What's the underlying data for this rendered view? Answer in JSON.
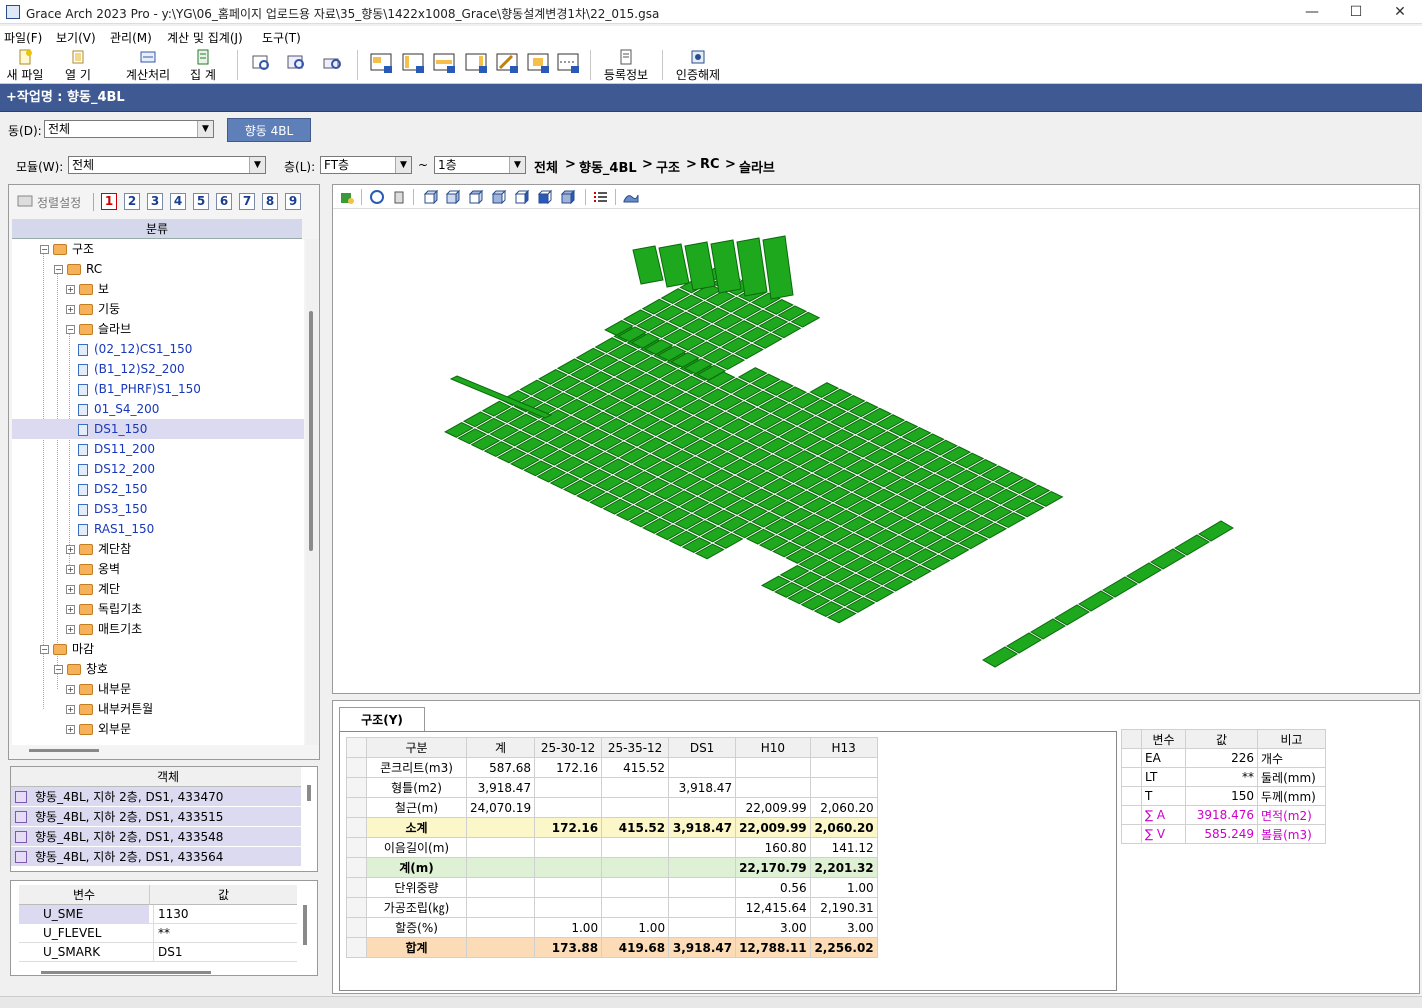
{
  "window": {
    "title": "Grace Arch 2023 Pro - y:\\YG\\06_홈페이지 업로드용 자료\\35_향동\\1422x1008_Grace\\향동설계변경1차\\22_015.gsa",
    "min": "—",
    "max": "☐",
    "close": "✕"
  },
  "menu": [
    "파일(F)",
    "보기(V)",
    "관리(M)",
    "계산 및 집계(J)",
    "도구(T)"
  ],
  "toolbar": {
    "new": "새 파일",
    "open": "열  기",
    "calc": "계산처리",
    "sum": "집  계",
    "reg": "등록정보",
    "auth": "인증해제"
  },
  "job": "+작업명 : 향동_4BL",
  "dong": {
    "label": "동(D):",
    "value": "전체",
    "tab": "향동 4BL"
  },
  "filters": {
    "module_label": "모듈(W):",
    "module_value": "전체",
    "floor_label": "층(L):",
    "floor_from": "FT층",
    "tilde": "~",
    "floor_to": "1층"
  },
  "breadcrumb": [
    "전체",
    "향동_4BL",
    "구조",
    "RC",
    "슬라브"
  ],
  "crumb_sep": ">",
  "left": {
    "sort_label": "정렬설정",
    "numbers": [
      "1",
      "2",
      "3",
      "4",
      "5",
      "6",
      "7",
      "8",
      "9"
    ],
    "tree_header": "분류"
  },
  "tree": [
    {
      "label": "구조",
      "kind": "folder",
      "exp": "−"
    },
    {
      "label": "RC",
      "kind": "folder",
      "exp": "−"
    },
    {
      "label": "보",
      "kind": "folder",
      "exp": "+"
    },
    {
      "label": "기둥",
      "kind": "folder",
      "exp": "+"
    },
    {
      "label": "슬라브",
      "kind": "folder",
      "exp": "−"
    },
    {
      "label": "(02_12)CS1_150",
      "kind": "doc"
    },
    {
      "label": "(B1_12)S2_200",
      "kind": "doc"
    },
    {
      "label": "(B1_PHRF)S1_150",
      "kind": "doc"
    },
    {
      "label": "01_S4_200",
      "kind": "doc"
    },
    {
      "label": "DS1_150",
      "kind": "doc",
      "selected": true
    },
    {
      "label": "DS11_200",
      "kind": "doc"
    },
    {
      "label": "DS12_200",
      "kind": "doc"
    },
    {
      "label": "DS2_150",
      "kind": "doc"
    },
    {
      "label": "DS3_150",
      "kind": "doc"
    },
    {
      "label": "RAS1_150",
      "kind": "doc"
    },
    {
      "label": "계단참",
      "kind": "folder",
      "exp": "+"
    },
    {
      "label": "옹벽",
      "kind": "folder",
      "exp": "+"
    },
    {
      "label": "계단",
      "kind": "folder",
      "exp": "+"
    },
    {
      "label": "독립기초",
      "kind": "folder",
      "exp": "+"
    },
    {
      "label": "매트기초",
      "kind": "folder",
      "exp": "+"
    },
    {
      "label": "마감",
      "kind": "folder",
      "exp": "−"
    },
    {
      "label": "창호",
      "kind": "folder",
      "exp": "−"
    },
    {
      "label": "내부문",
      "kind": "folder",
      "exp": "+"
    },
    {
      "label": "내부커튼월",
      "kind": "folder",
      "exp": "+"
    },
    {
      "label": "외부문",
      "kind": "folder",
      "exp": "+"
    }
  ],
  "objects": {
    "header": "객체",
    "rows": [
      "향동_4BL, 지하 2층, DS1, 433470",
      "향동_4BL, 지하 2층, DS1, 433515",
      "향동_4BL, 지하 2층, DS1, 433548",
      "향동_4BL, 지하 2층, DS1, 433564"
    ]
  },
  "vars": {
    "h1": "변수",
    "h2": "값",
    "rows": [
      [
        "U_SME",
        "1130"
      ],
      [
        "U_FLEVEL",
        "**"
      ],
      [
        "U_SMARK",
        "DS1"
      ]
    ]
  },
  "grid": {
    "tab": "구조(Y)",
    "headers": [
      "구분",
      "계",
      "25-30-12",
      "25-35-12",
      "DS1",
      "H10",
      "H13"
    ],
    "rows": [
      {
        "cells": [
          "콘크리트(m3)",
          "587.68",
          "172.16",
          "415.52",
          "",
          "",
          ""
        ],
        "style": ""
      },
      {
        "cells": [
          "형틀(m2)",
          "3,918.47",
          "",
          "",
          "3,918.47",
          "",
          ""
        ],
        "style": ""
      },
      {
        "cells": [
          "철근(m)",
          "24,070.19",
          "",
          "",
          "",
          "22,009.99",
          "2,060.20"
        ],
        "style": ""
      },
      {
        "cells": [
          "소계",
          "",
          "172.16",
          "415.52",
          "3,918.47",
          "22,009.99",
          "2,060.20"
        ],
        "style": "yel b"
      },
      {
        "cells": [
          "이음길이(m)",
          "",
          "",
          "",
          "",
          "160.80",
          "141.12"
        ],
        "style": ""
      },
      {
        "cells": [
          "계(m)",
          "",
          "",
          "",
          "",
          "22,170.79",
          "2,201.32"
        ],
        "style": "grn b"
      },
      {
        "cells": [
          "단위중량",
          "",
          "",
          "",
          "",
          "0.56",
          "1.00"
        ],
        "style": ""
      },
      {
        "cells": [
          "가공조립(㎏)",
          "",
          "",
          "",
          "",
          "12,415.64",
          "2,190.31"
        ],
        "style": ""
      },
      {
        "cells": [
          "할증(%)",
          "",
          "1.00",
          "1.00",
          "",
          "3.00",
          "3.00"
        ],
        "style": ""
      },
      {
        "cells": [
          "합계",
          "",
          "173.88",
          "419.68",
          "3,918.47",
          "12,788.11",
          "2,256.02"
        ],
        "style": "org b"
      }
    ]
  },
  "props": {
    "headers": [
      "변수",
      "값",
      "비고"
    ],
    "rows": [
      {
        "name": "EA",
        "value": "226",
        "note": "개수",
        "mag": false
      },
      {
        "name": "LT",
        "value": "**",
        "note": "둘레(mm)",
        "mag": false
      },
      {
        "name": "T",
        "value": "150",
        "note": "두께(mm)",
        "mag": false
      },
      {
        "name": "∑ A",
        "value": "3918.476",
        "note": "면적(m2)",
        "mag": true
      },
      {
        "name": "∑ V",
        "value": "585.249",
        "note": "볼륨(m3)",
        "mag": true
      }
    ]
  },
  "colors": {
    "slab": "#1ea81e",
    "slab_edge": "#0b6a0b",
    "job_bar": "#3f5a93",
    "subtotal": "#fbf7c9",
    "line_total": "#dff1d4",
    "grand_total": "#fbdcb6",
    "highlight": "#cc00cc"
  }
}
